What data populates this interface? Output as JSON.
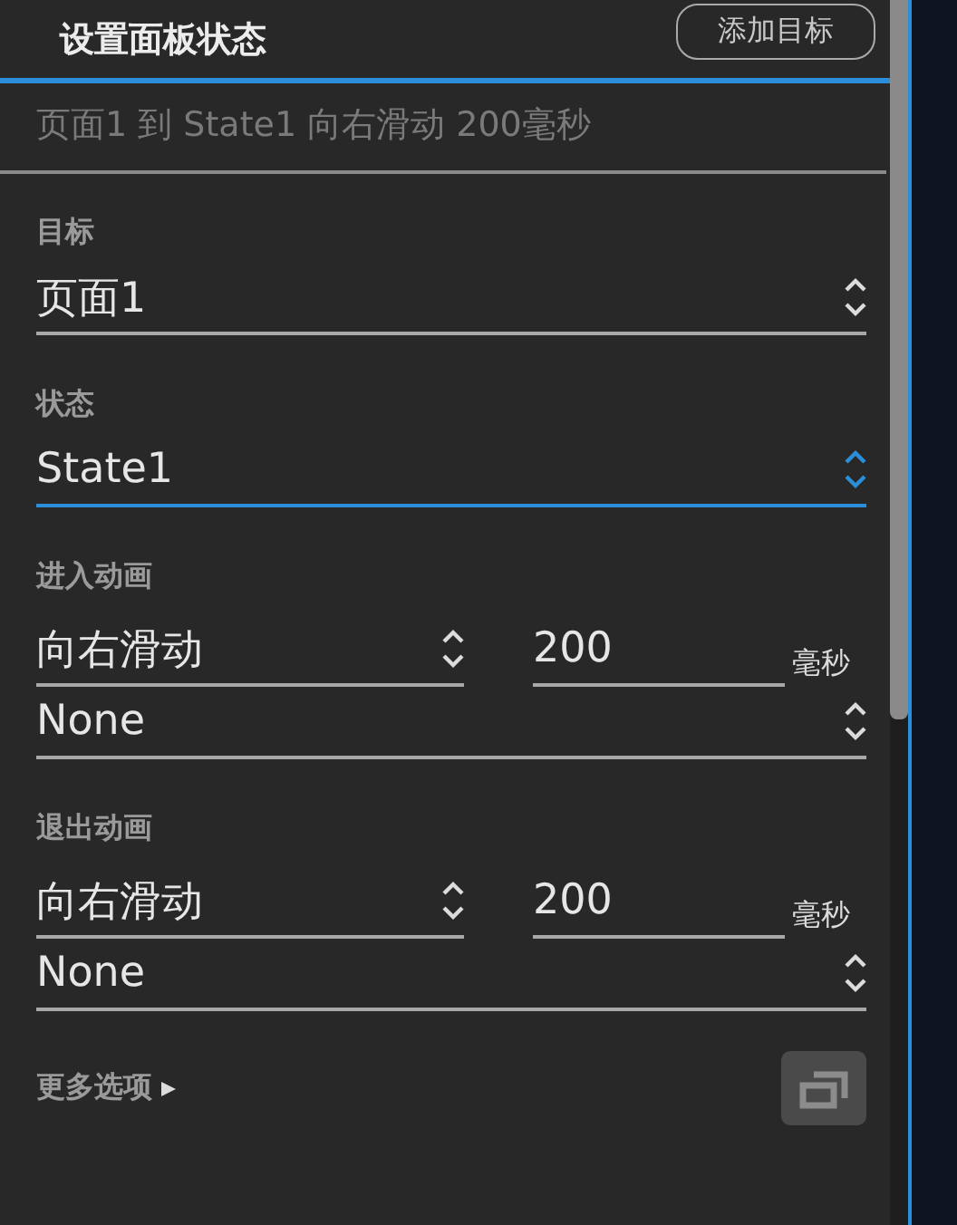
{
  "header": {
    "title": "设置面板状态",
    "add_button": "添加目标"
  },
  "summary": "页面1 到 State1 向右滑动 200毫秒",
  "target": {
    "label": "目标",
    "value": "页面1",
    "focused": false
  },
  "state": {
    "label": "状态",
    "value": "State1",
    "focused": true
  },
  "animations": [
    {
      "label": "进入动画",
      "effect": "向右滑动",
      "duration": "200",
      "unit": "毫秒",
      "easing": "None"
    },
    {
      "label": "退出动画",
      "effect": "向右滑动",
      "duration": "200",
      "unit": "毫秒",
      "easing": "None"
    }
  ],
  "more_options": {
    "label": "更多选项",
    "expanded": false
  }
}
